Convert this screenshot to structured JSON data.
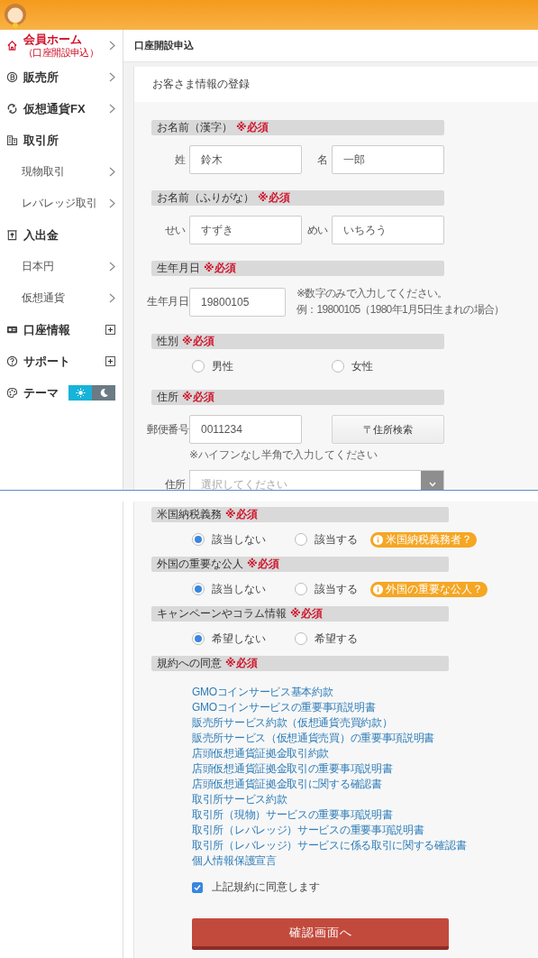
{
  "sidebar": {
    "items": [
      {
        "kind": "main",
        "label": "会員ホーム",
        "note": "（口座開設申込）",
        "selected": true,
        "arrow": true
      },
      {
        "kind": "main",
        "label": "販売所",
        "selected": false,
        "arrow": true
      },
      {
        "kind": "main",
        "label": "仮想通貨FX",
        "selected": false,
        "arrow": true
      },
      {
        "kind": "main",
        "label": "取引所",
        "selected": false,
        "arrow": false
      },
      {
        "kind": "sub",
        "label": "現物取引",
        "selected": false,
        "arrow": true
      },
      {
        "kind": "sub",
        "label": "レバレッジ取引",
        "selected": false,
        "arrow": true
      },
      {
        "kind": "main",
        "label": "入出金",
        "selected": false,
        "arrow": false
      },
      {
        "kind": "sub",
        "label": "日本円",
        "selected": false,
        "arrow": true
      },
      {
        "kind": "sub",
        "label": "仮想通貨",
        "selected": false,
        "arrow": true
      },
      {
        "kind": "main",
        "label": "口座情報",
        "selected": false,
        "arrow": false,
        "expanded": false
      },
      {
        "kind": "main",
        "label": "サポート",
        "selected": false,
        "arrow": false,
        "expanded": false
      },
      {
        "kind": "main",
        "label": "テーマ",
        "selected": false,
        "arrow": false,
        "toggle": [
          {
            "kind": "light",
            "selected": true
          },
          {
            "kind": "dark",
            "selected": false
          }
        ]
      }
    ]
  },
  "page_title": "口座開設申込",
  "form": {
    "title": "お客さま情報の登録",
    "sections": [
      {
        "kind": "pair",
        "label": "お名前（漢字）",
        "required": "※必須",
        "fields": [
          {
            "label": "姓",
            "value": "鈴木"
          },
          {
            "label": "名",
            "value": "一郎"
          }
        ]
      },
      {
        "kind": "pair",
        "label": "お名前（ふりがな）",
        "required": "※必須",
        "fields": [
          {
            "label": "せい",
            "value": "すずき"
          },
          {
            "label": "めい",
            "value": "いちろう"
          }
        ]
      },
      {
        "kind": "date",
        "label": "生年月日",
        "required": "※必須",
        "fields": [
          {
            "label": "生年月日",
            "value": "19800105"
          }
        ],
        "hints": [
          "※数字のみで入力してください。",
          "例：19800105（1980年1月5日生まれの場合）"
        ]
      },
      {
        "kind": "radio",
        "label": "性別",
        "required": "※必須",
        "options": [
          {
            "label": "男性",
            "selected": false
          },
          {
            "label": "女性",
            "selected": false
          }
        ]
      },
      {
        "kind": "address",
        "label": "住所",
        "required": "※必須",
        "fields": [
          {
            "label": "郵便番号",
            "value": "0011234"
          }
        ],
        "button": "〒住所検索",
        "hints": [
          "※ハイフンなし半角で入力してください"
        ],
        "select": {
          "label": "住所",
          "placeholder": "選択してください"
        }
      }
    ]
  },
  "continued": {
    "sections": [
      {
        "kind": "radio",
        "label": "米国納税義務",
        "required": "※必須",
        "options": [
          {
            "label": "該当しない",
            "selected": true
          },
          {
            "label": "該当する",
            "selected": false
          }
        ],
        "info": "米国納税義務者？"
      },
      {
        "kind": "radio",
        "label": "外国の重要な公人",
        "required": "※必須",
        "options": [
          {
            "label": "該当しない",
            "selected": true
          },
          {
            "label": "該当する",
            "selected": false
          }
        ],
        "info": "外国の重要な公人？"
      },
      {
        "kind": "radio",
        "label": "キャンペーンやコラム情報",
        "required": "※必須",
        "options": [
          {
            "label": "希望しない",
            "selected": true
          },
          {
            "label": "希望する",
            "selected": false
          }
        ]
      },
      {
        "kind": "terms",
        "label": "規約への同意",
        "required": "※必須",
        "links": [
          "GMOコインサービス基本約款",
          "GMOコインサービスの重要事項説明書",
          "販売所サービス約款（仮想通貨売買約款）",
          "販売所サービス（仮想通貨売買）の重要事項説明書",
          "店頭仮想通貨証拠金取引約款",
          "店頭仮想通貨証拠金取引の重要事項説明書",
          "店頭仮想通貨証拠金取引に関する確認書",
          "取引所サービス約款",
          "取引所（現物）サービスの重要事項説明書",
          "取引所（レバレッジ）サービスの重要事項説明書",
          "取引所（レバレッジ）サービスに係る取引に関する確認書",
          "個人情報保護宣言"
        ],
        "agree": {
          "label": "上記規約に同意します",
          "checked": true
        }
      }
    ],
    "submit": "確認画面へ"
  }
}
